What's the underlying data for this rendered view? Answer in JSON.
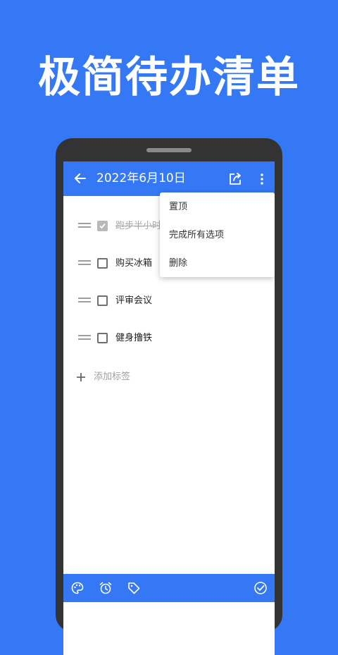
{
  "promo": {
    "headline": "极简待办清单"
  },
  "appbar": {
    "title": "2022年6月10日"
  },
  "todos": [
    {
      "label": "跑步半小时",
      "done": true
    },
    {
      "label": "购买冰箱",
      "done": false
    },
    {
      "label": "评审会议",
      "done": false
    },
    {
      "label": "健身撸铁",
      "done": false
    }
  ],
  "add_tag": {
    "label": "添加标签"
  },
  "menu": {
    "items": [
      "置顶",
      "完成所有选项",
      "删除"
    ]
  },
  "colors": {
    "accent": "#3478F6",
    "phone_frame": "#333333"
  },
  "icons": {
    "back": "arrow-left-icon",
    "share": "share-icon",
    "more": "more-vert-icon",
    "palette": "palette-icon",
    "alarm": "alarm-icon",
    "tag": "tag-icon",
    "done": "check-circle-icon"
  }
}
